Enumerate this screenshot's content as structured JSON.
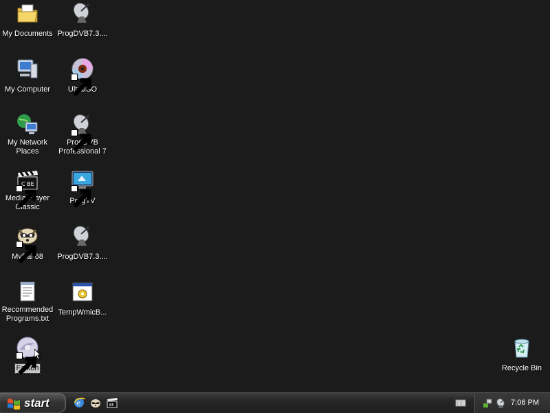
{
  "desktop": {
    "icons": [
      {
        "label": "My Documents",
        "icon": "folder-documents-icon"
      },
      {
        "label": "ProgDVB7.3....",
        "icon": "satellite-dish-icon"
      },
      {
        "label": "My Computer",
        "icon": "computer-icon"
      },
      {
        "label": "UltraISO",
        "icon": "disc-icon"
      },
      {
        "label": "My Network Places",
        "icon": "network-globe-icon"
      },
      {
        "label": "ProgDVB Professional 7",
        "icon": "satellite-dish-icon"
      },
      {
        "label": "Media Player Classic",
        "icon": "clapperboard-icon"
      },
      {
        "label": "ProgTV",
        "icon": "tv-monitor-icon"
      },
      {
        "label": "MyPal 68",
        "icon": "raccoon-icon"
      },
      {
        "label": "ProgDVB7.3....",
        "icon": "satellite-dish-icon"
      },
      {
        "label": "Recommended Programs.txt",
        "icon": "text-file-icon"
      },
      {
        "label": "TempWmicB...",
        "icon": "batch-file-icon"
      },
      {
        "label": "Falkon",
        "icon": "falkon-icon"
      },
      {
        "label": "Recycle Bin",
        "icon": "recycle-bin-icon"
      }
    ]
  },
  "taskbar": {
    "start_label": "start",
    "quick_launch": [
      "internet-explorer-icon",
      "raccoon-icon",
      "clapperboard-icon"
    ],
    "clock": "7:06 PM"
  },
  "colors": {
    "desktop_background": "#1b1b1b",
    "taskbar": "#262626",
    "selection": "#c8c8c8"
  }
}
